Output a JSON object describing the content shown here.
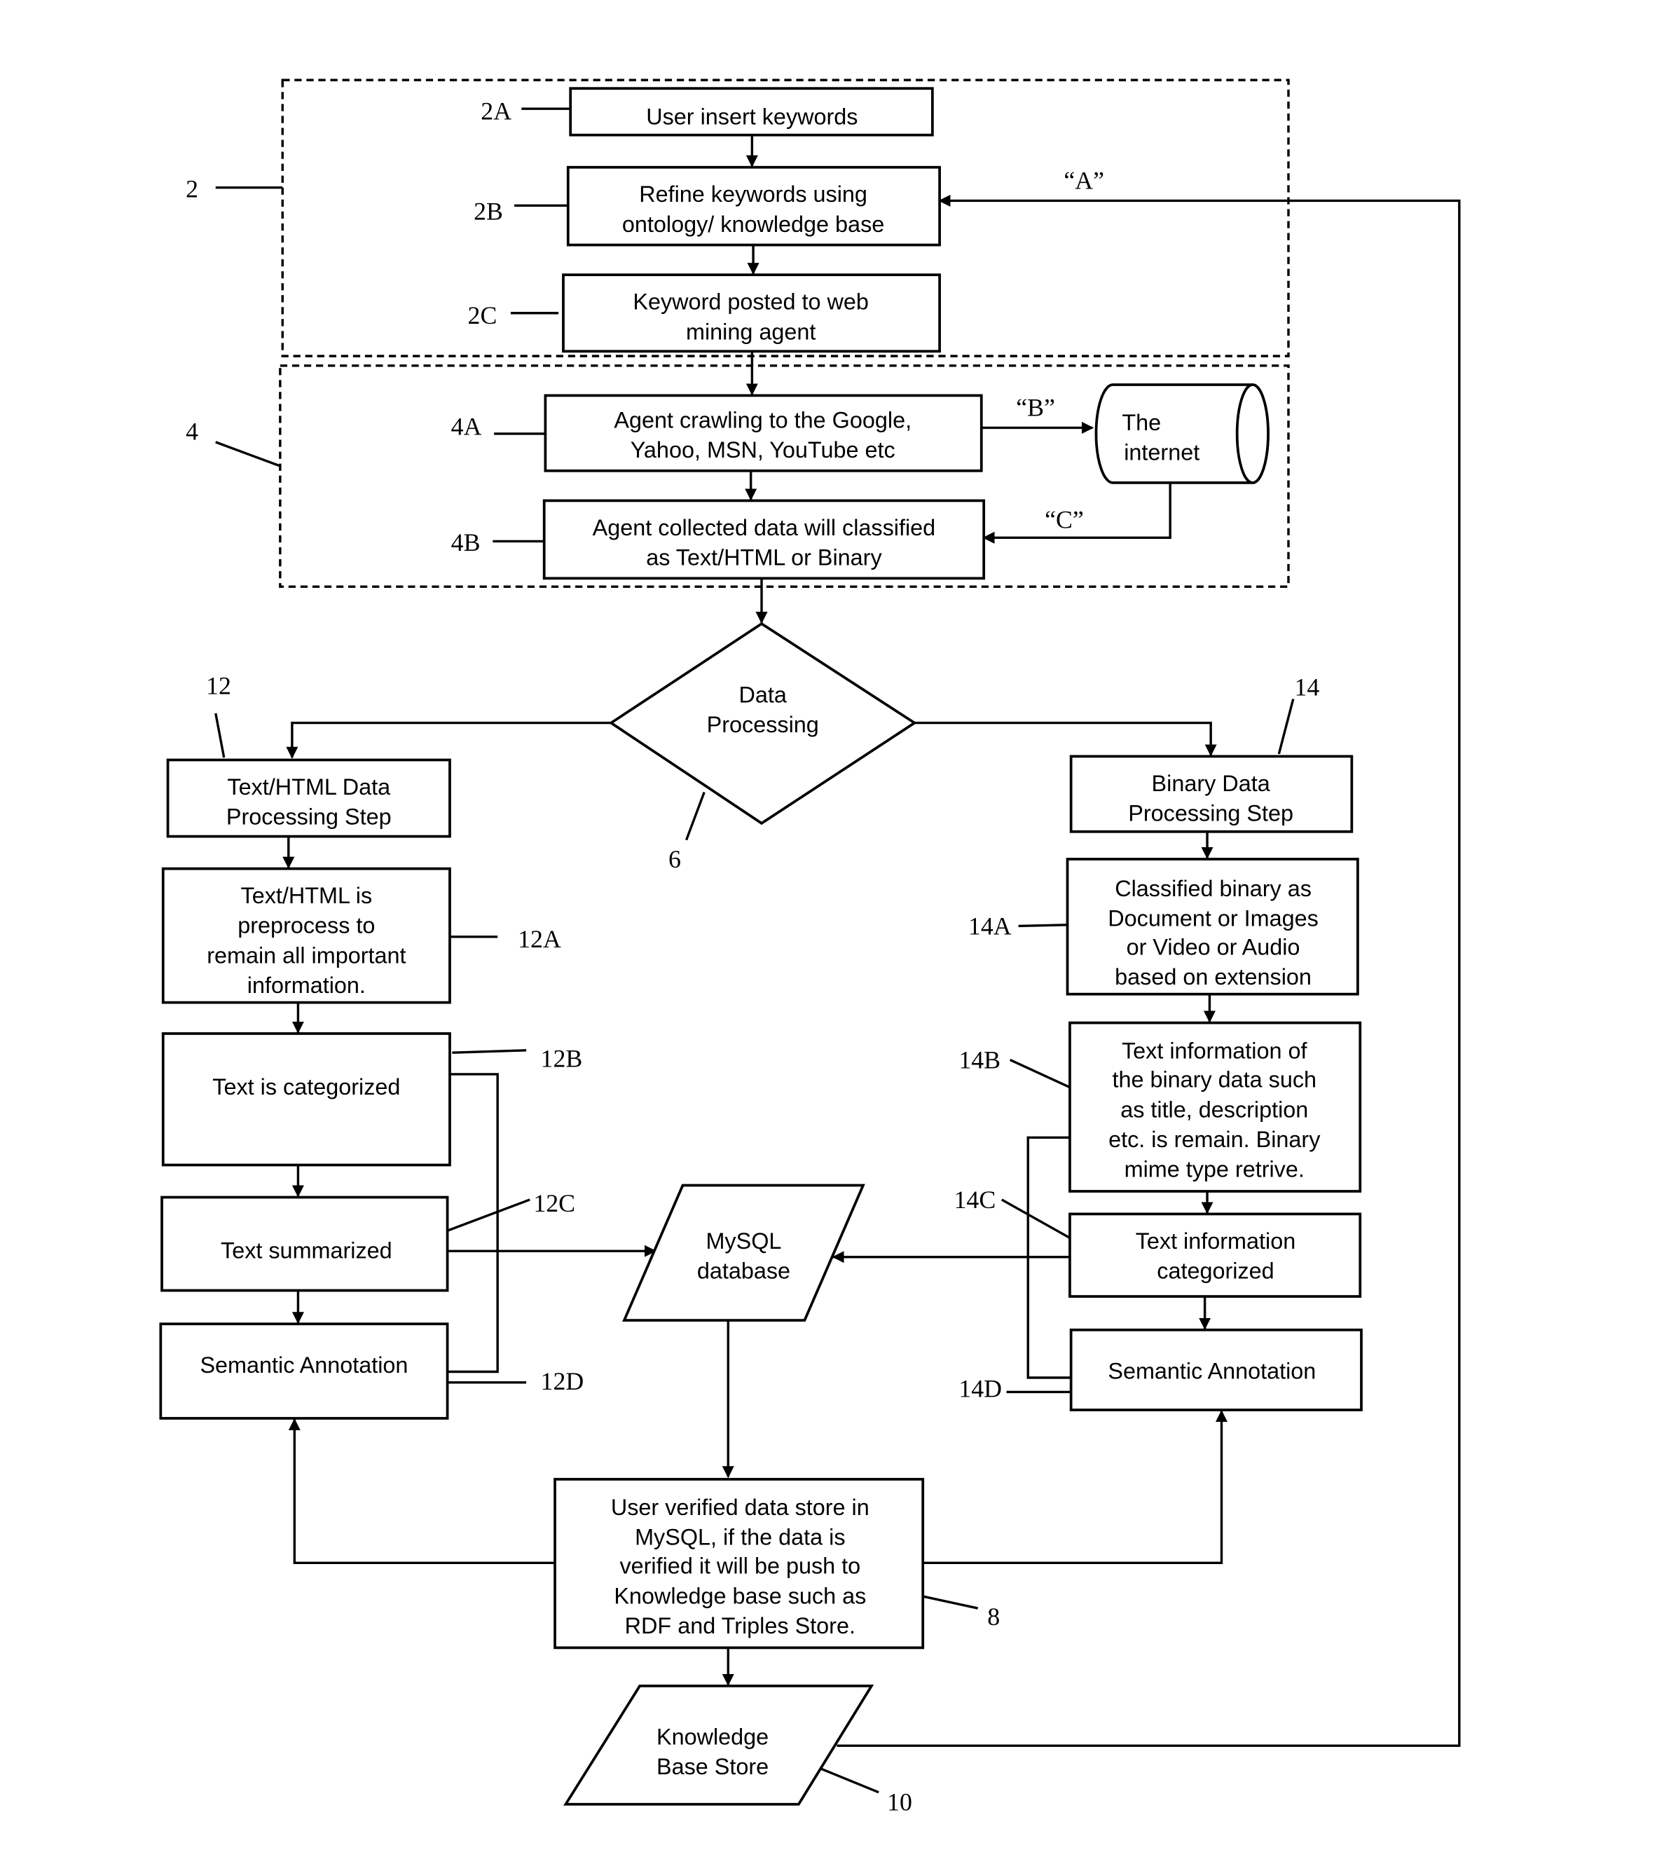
{
  "groups": {
    "g2": {
      "ref": "2"
    },
    "g4": {
      "ref": "4"
    }
  },
  "steps": {
    "s2A": {
      "ref": "2A",
      "lines": [
        "User insert keywords"
      ]
    },
    "s2B": {
      "ref": "2B",
      "lines": [
        "Refine keywords using",
        "ontology/ knowledge base"
      ]
    },
    "s2C": {
      "ref": "2C",
      "lines": [
        "Keyword posted to web",
        "mining agent"
      ]
    },
    "s4A": {
      "ref": "4A",
      "lines": [
        "Agent crawling to the Google,",
        "Yahoo, MSN, YouTube etc"
      ]
    },
    "s4B": {
      "ref": "4B",
      "lines": [
        "Agent collected data will classified",
        "as Text/HTML or Binary"
      ]
    },
    "internet": {
      "lines": [
        "The",
        "internet"
      ]
    },
    "decision": {
      "ref": "6",
      "lines": [
        "Data",
        "Processing"
      ]
    },
    "s12": {
      "ref": "12",
      "lines": [
        "Text/HTML Data",
        "Processing Step"
      ]
    },
    "s12A": {
      "ref": "12A",
      "lines": [
        "Text/HTML is",
        "preprocess to",
        "remain all important",
        "information."
      ]
    },
    "s12B": {
      "ref": "12B",
      "lines": [
        "Text is categorized"
      ]
    },
    "s12C": {
      "ref": "12C",
      "lines": [
        "Text summarized"
      ]
    },
    "s12D": {
      "ref": "12D",
      "lines": [
        "Semantic Annotation"
      ]
    },
    "s14": {
      "ref": "14",
      "lines": [
        "Binary Data",
        "Processing Step"
      ]
    },
    "s14A": {
      "ref": "14A",
      "lines": [
        "Classified binary as",
        "Document or Images",
        "or Video or Audio",
        "based on extension"
      ]
    },
    "s14B": {
      "ref": "14B",
      "lines": [
        "Text information of",
        "the binary data such",
        "as title, description",
        "etc. is remain. Binary",
        "mime type retrive."
      ]
    },
    "s14C": {
      "ref": "14C",
      "lines": [
        "Text information",
        "categorized"
      ]
    },
    "s14D": {
      "ref": "14D",
      "lines": [
        "Semantic Annotation"
      ]
    },
    "mysql": {
      "lines": [
        "MySQL",
        "database"
      ]
    },
    "s8": {
      "ref": "8",
      "lines": [
        "User verified data store in",
        "MySQL, if the data is",
        "verified it will be push to",
        "Knowledge base such as",
        "RDF and Triples Store."
      ]
    },
    "s10": {
      "ref": "10",
      "lines": [
        "Knowledge",
        "Base Store"
      ]
    }
  },
  "edge_labels": {
    "A": "“A”",
    "B": "“B”",
    "C": "“C”"
  }
}
